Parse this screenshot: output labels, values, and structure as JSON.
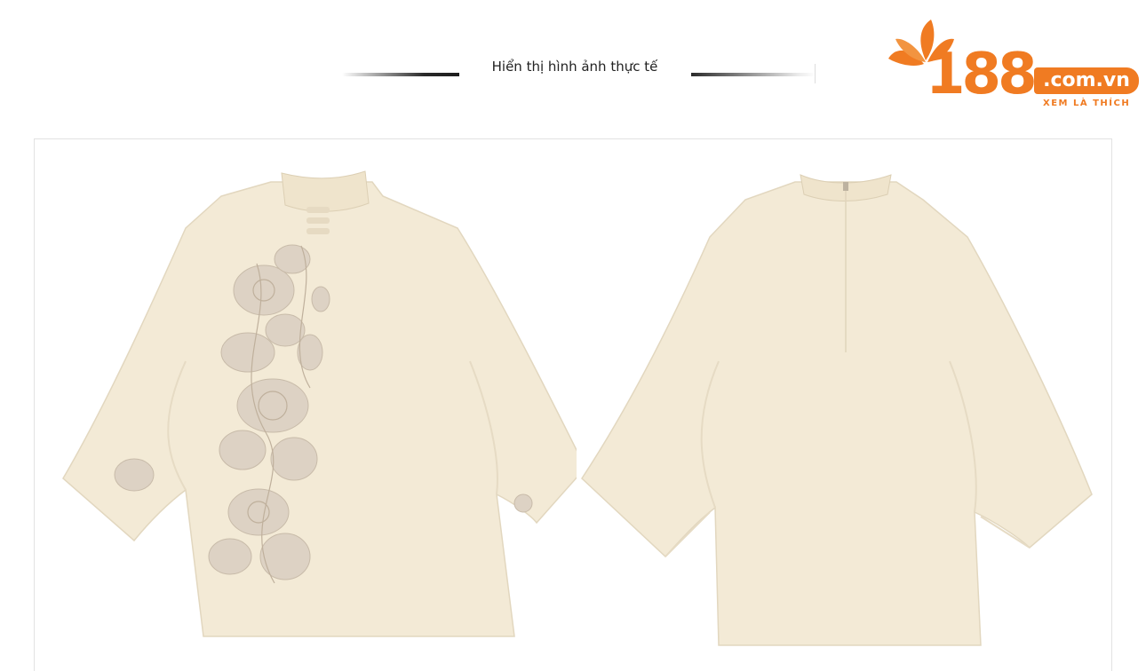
{
  "header": {
    "section_title": "Hiển thị hình ảnh thực tế"
  },
  "logo": {
    "number": "188",
    "domain": ".com.vn",
    "slogan": "XEM LÀ THÍCH",
    "brand_color": "#f07b22"
  },
  "product_images": [
    {
      "view": "front",
      "garment_color": "#f3ead6",
      "embroidery_color": "#d9cfc2"
    },
    {
      "view": "back",
      "garment_color": "#f3ead6"
    }
  ]
}
